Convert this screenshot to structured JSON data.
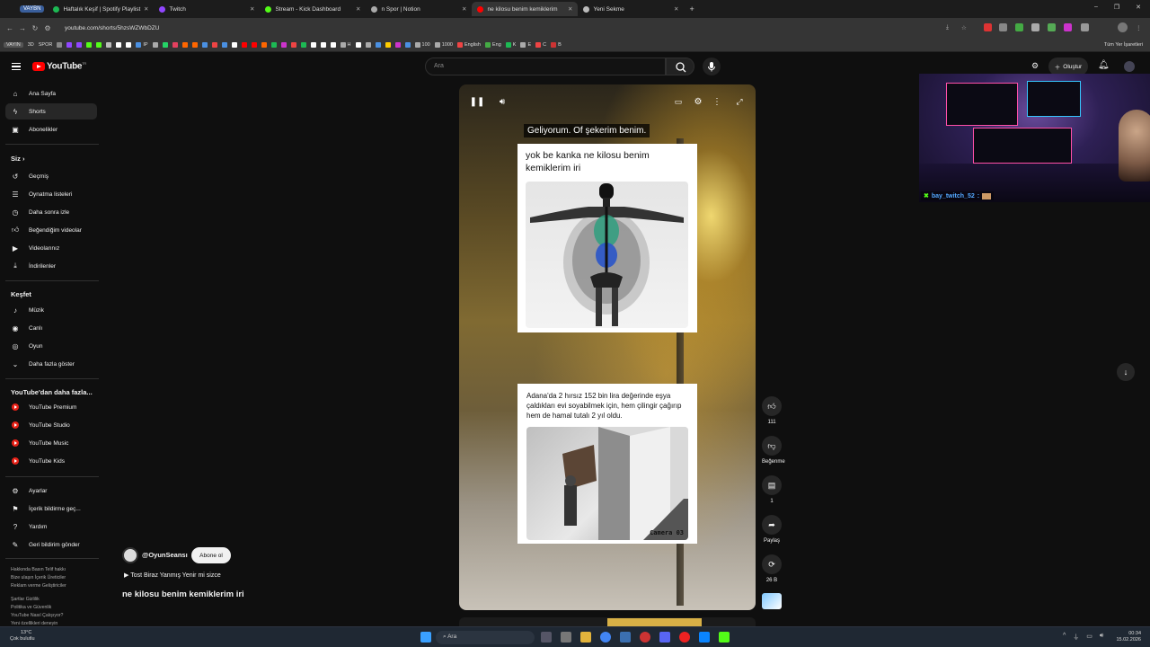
{
  "browser": {
    "vaybn_label": "VAYBN",
    "tabs": [
      {
        "title": "Haftalık Keşif | Spotify Playlist",
        "color": "#1db954"
      },
      {
        "title": "Twitch",
        "color": "#9146ff"
      },
      {
        "title": "Stream - Kick Dashboard",
        "color": "#53fc18"
      },
      {
        "title": "n Spor | Notion",
        "color": "#aaaaaa"
      },
      {
        "title": "ne kilosu benim kemiklerim",
        "color": "#ff0000"
      },
      {
        "title": "Yeni Sekme",
        "color": "#bbbbbb"
      }
    ],
    "url": "youtube.com/shorts/5hzsWZWbDZU",
    "bookmarks": [
      "VAYIN",
      "3D",
      "SPOR",
      "IP",
      "H",
      "100",
      "1000",
      "English",
      "Eng",
      "K",
      "E",
      "C",
      "B"
    ],
    "all_bookmarks_label": "Tüm Yer İşaretleri"
  },
  "youtube": {
    "logo_text": "YouTube",
    "logo_country": "TR",
    "search_placeholder": "Ara",
    "create_label": "Oluştur",
    "sidebar": {
      "main": [
        {
          "label": "Ana Sayfa",
          "icon": "home-icon"
        },
        {
          "label": "Shorts",
          "icon": "shorts-icon"
        },
        {
          "label": "Abonelikler",
          "icon": "subscriptions-icon"
        }
      ],
      "you_header": "Siz",
      "you_items": [
        {
          "label": "Geçmiş",
          "icon": "history-icon"
        },
        {
          "label": "Oynatma listeleri",
          "icon": "playlists-icon"
        },
        {
          "label": "Daha sonra izle",
          "icon": "watch-later-icon"
        },
        {
          "label": "Beğendiğim videolar",
          "icon": "liked-icon"
        },
        {
          "label": "Videolarınız",
          "icon": "your-videos-icon"
        },
        {
          "label": "İndirilenler",
          "icon": "download-icon"
        }
      ],
      "explore_header": "Keşfet",
      "explore_items": [
        {
          "label": "Müzik",
          "icon": "music-icon"
        },
        {
          "label": "Canlı",
          "icon": "live-icon"
        },
        {
          "label": "Oyun",
          "icon": "gaming-icon"
        },
        {
          "label": "Daha fazla göster",
          "icon": "chevron-down-icon"
        }
      ],
      "more_header": "YouTube'dan daha fazla...",
      "more_items": [
        "YouTube Premium",
        "YouTube Studio",
        "YouTube Music",
        "YouTube Kids"
      ],
      "settings_items": [
        {
          "label": "Ayarlar",
          "icon": "gear-icon"
        },
        {
          "label": "İçerik bildirme geç...",
          "icon": "flag-icon"
        },
        {
          "label": "Yardım",
          "icon": "help-icon"
        },
        {
          "label": "Geri bildirim gönder",
          "icon": "feedback-icon"
        }
      ],
      "footer": [
        "Hakkında  Basın  Telif hakkı",
        "Bize ulaşın  İçerik Üreticiler",
        "Reklam verme  Geliştiriciler",
        "",
        "Şartlar  Gizlilik",
        "Politika ve Güvenlik",
        "YouTube Nasıl Çalışıyor?",
        "Yeni özellikleri deneyin"
      ]
    },
    "short": {
      "caption": "Geliyorum. Of şekerim benim.",
      "card1_text": "yok be kanka ne kilosu benim kemiklerim iri",
      "card2_text": "Adana'da 2 hırsız 152 bin lira değerinde eşya çaldıkları evi soyabilmek için, hem çilingir çağırıp hem de hamal tutalı 2 yıl oldu.",
      "camera_label": "Camera 03",
      "channel": "@OyunSeansı",
      "subscribe_label": "Abone ol",
      "music": "Tost Biraz Yanmış Yenir mi sizce",
      "title": "ne kilosu benim kemiklerim iri"
    },
    "actions": {
      "like_count": "111",
      "dislike_label": "Beğenme",
      "comment_count": "1",
      "share_label": "Paylaş",
      "remix_count": "26 B"
    }
  },
  "overlay": {
    "chat_user": "bay_twitch_52",
    "chat_sep": ":"
  },
  "taskbar": {
    "temp": "13°C",
    "weather": "Çok bulutlu",
    "search": "Ara",
    "time": "00:34",
    "date": "15.02.2026"
  }
}
